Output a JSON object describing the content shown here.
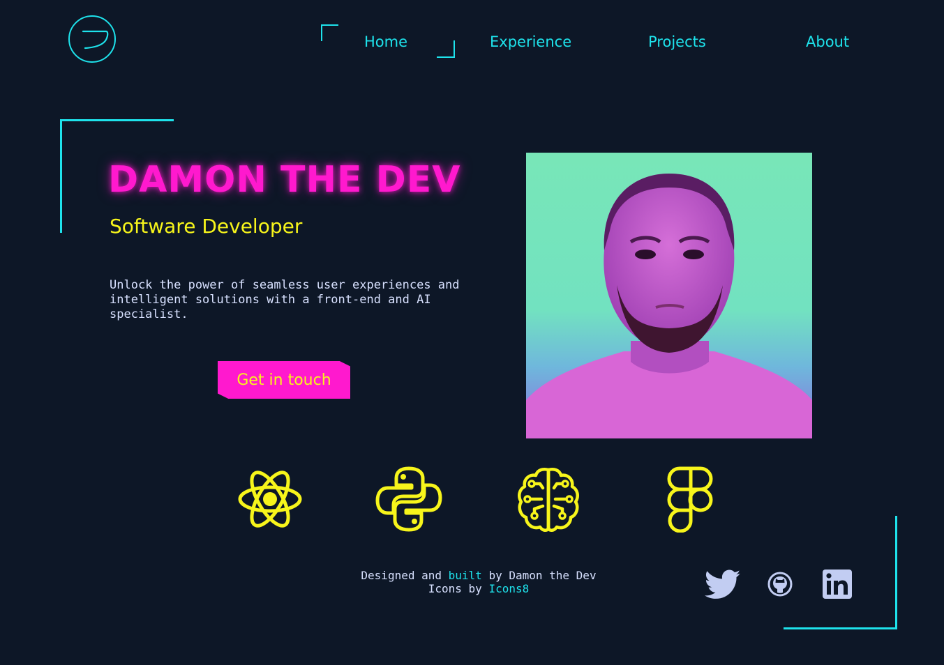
{
  "colors": {
    "background": "#0d1727",
    "accent_cyan": "#1ee3ec",
    "accent_magenta": "#ff19ce",
    "accent_yellow": "#f7f51b",
    "text_light": "#d8e1ff"
  },
  "nav": {
    "logo_icon": "logo-circle-icon",
    "items": [
      {
        "label": "Home"
      },
      {
        "label": "Experience"
      },
      {
        "label": "Projects"
      },
      {
        "label": "About"
      }
    ]
  },
  "hero": {
    "title": "DAMON THE DEV",
    "subtitle": "Software Developer",
    "description": "Unlock the power of seamless user experiences and intelligent solutions with a front-end and AI specialist.",
    "cta_label": "Get in touch"
  },
  "skills": [
    {
      "icon": "react-icon"
    },
    {
      "icon": "python-icon"
    },
    {
      "icon": "ai-brain-icon"
    },
    {
      "icon": "figma-icon"
    }
  ],
  "footer": {
    "line1_prefix": "Designed and ",
    "line1_link": "built",
    "line1_suffix": " by Damon the Dev",
    "line2_prefix": "Icons by ",
    "line2_link": "Icons8"
  },
  "social": [
    {
      "icon": "twitter-icon"
    },
    {
      "icon": "github-icon"
    },
    {
      "icon": "linkedin-icon"
    }
  ]
}
